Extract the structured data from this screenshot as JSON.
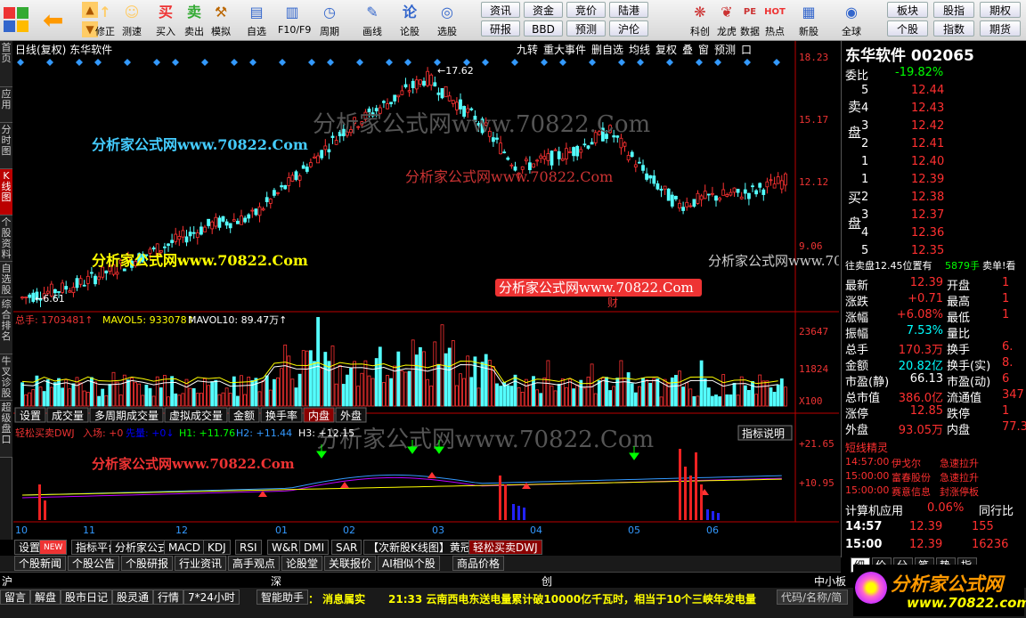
{
  "toolbar": {
    "items": [
      {
        "label": "修正",
        "icon": "↑"
      },
      {
        "label": "测速",
        "icon": "☺"
      },
      {
        "label": "买入",
        "icon": "买"
      },
      {
        "label": "卖出",
        "icon": "卖"
      },
      {
        "label": "模拟",
        "icon": "⚒"
      },
      {
        "label": "自选",
        "icon": "▤"
      },
      {
        "label": "F10/F9",
        "icon": "▥"
      },
      {
        "label": "周期",
        "icon": "◷"
      },
      {
        "label": "画线",
        "icon": "✎"
      },
      {
        "label": "论股",
        "icon": "论"
      },
      {
        "label": "选股",
        "icon": "◎"
      },
      {
        "label": "科创",
        "icon": "❋"
      },
      {
        "label": "龙虎",
        "icon": "❦"
      },
      {
        "label": "数据",
        "icon": "PE"
      },
      {
        "label": "热点",
        "icon": "HOT"
      },
      {
        "label": "新股",
        "icon": "▦"
      },
      {
        "label": "全球",
        "icon": "◉"
      }
    ],
    "quick": [
      [
        "资讯",
        "研报"
      ],
      [
        "资金",
        "BBD"
      ],
      [
        "竞价",
        "预测"
      ],
      [
        "陆港",
        "沪伦"
      ]
    ],
    "right": [
      [
        "板块",
        "个股"
      ],
      [
        "股指",
        "指数"
      ],
      [
        "期权",
        "期货"
      ]
    ]
  },
  "leftnav": [
    "首页",
    "应用",
    "分时图",
    "K线图",
    "个股资料",
    "自选股",
    "综合排名",
    "牛叉诊股",
    "超级盘口"
  ],
  "chart": {
    "title": "日线(复权) 东华软件",
    "options": [
      "九转",
      "重大事件",
      "删自选",
      "均线",
      "复权",
      "叠",
      "窗",
      "预测",
      "口"
    ],
    "price_axis": [
      "18.23",
      "15.17",
      "12.12",
      "9.06"
    ],
    "high_label": "17.62",
    "low_label": "6.61",
    "cai": "财",
    "watermarks": [
      "分析家公式网www.70822.Com",
      "分析家公式网www.70822.Com",
      "分析家公式网www.70822.Com",
      "分析家公式网www.70822.Com",
      "分析家公式网www.70822.Com",
      "分析家公式网www.70822.Com",
      "分析家公式网www.70822.Com"
    ],
    "volume_header": {
      "total": "总手: 1703481↑",
      "ma5": "MAVOL5: 933078↑",
      "ma10": "MAVOL10: 89.47万↑"
    },
    "volume_axis": [
      "23647",
      "11824",
      "X100"
    ],
    "tabs1": [
      "设置",
      "成交量",
      "多周期成交量",
      "虚拟成交量",
      "金额",
      "换手率",
      "内盘",
      "外盘"
    ],
    "indicator_header": {
      "name": "轻松买卖DWJ",
      "entry": "入场: +0",
      "first": "先量: +0↓",
      "h1": "H1: +11.76",
      "h2": "H2: +11.44",
      "h3": "H3: +12.15"
    },
    "indicator_axis": [
      "+21.65",
      "+10.95"
    ],
    "indicator_button": "指标说明",
    "x_axis": [
      "10",
      "11",
      "12",
      "01",
      "02",
      "03",
      "04",
      "05",
      "06"
    ]
  },
  "chart_data": {
    "type": "candlestick",
    "title": "日线(复权) 东华软件",
    "ylim": [
      6.61,
      18.23
    ],
    "x": [
      "10",
      "11",
      "12",
      "01",
      "02",
      "03",
      "04",
      "05",
      "06"
    ],
    "series": [
      {
        "name": "收盘",
        "values": [
          6.61,
          7.2,
          8.4,
          9.6,
          12.5,
          17.62,
          13.4,
          15.2,
          12.12,
          12.39
        ]
      }
    ]
  },
  "rpanel": {
    "title": "东华软件 002065",
    "webi": "委比",
    "webi_val": "-19.82%",
    "sell": [
      [
        "5",
        "12.44"
      ],
      [
        "4",
        "12.43"
      ],
      [
        "3",
        "12.42"
      ],
      [
        "2",
        "12.41"
      ],
      [
        "1",
        "12.40"
      ]
    ],
    "buy": [
      [
        "1",
        "12.39"
      ],
      [
        "2",
        "12.38"
      ],
      [
        "3",
        "12.37"
      ],
      [
        "4",
        "12.36"
      ],
      [
        "5",
        "12.35"
      ]
    ],
    "sell_label": "卖盘",
    "buy_label": "买盘",
    "info": "往卖盘12.45位置有",
    "info2": "5879手",
    "info3": "卖单!看",
    "stats": [
      [
        "最新",
        "12.39",
        "开盘",
        "1"
      ],
      [
        "涨跌",
        "+0.71",
        "最高",
        "1"
      ],
      [
        "涨幅",
        "+6.08%",
        "最低",
        "1"
      ],
      [
        "振幅",
        "7.53%",
        "量比",
        ""
      ],
      [
        "总手",
        "170.3万",
        "换手",
        "6."
      ],
      [
        "金额",
        "20.82亿",
        "换手(实)",
        "8."
      ],
      [
        "市盈(静)",
        "66.13",
        "市盈(动)",
        "6"
      ],
      [
        "总市值",
        "386.0亿",
        "流通值",
        "347"
      ],
      [
        "涨停",
        "12.85",
        "跌停",
        "1"
      ],
      [
        "外盘",
        "93.05万",
        "内盘",
        "77.3"
      ]
    ],
    "shortline": "短线精灵",
    "events": [
      [
        "14:57:00",
        "伊戈尔",
        "急速拉升"
      ],
      [
        "15:00:00",
        "富春股份",
        "急速拉升"
      ],
      [
        "15:00:00",
        "赛意信息",
        "封涨停板"
      ]
    ],
    "calc": "计算机应用",
    "calc_val": "0.06%",
    "calc_r": "同行比",
    "ticks": [
      [
        "14:57",
        "12.39",
        "155"
      ],
      [
        "15:00",
        "12.39",
        "16236"
      ]
    ],
    "bottom_tabs": [
      "细",
      "价",
      "分",
      "笔",
      "势",
      "指"
    ]
  },
  "btm1": [
    "设置",
    "NEW",
    "指标平台",
    "分析家公式网",
    "MACD",
    "KDJ",
    "RSI",
    "W&R",
    "DMI",
    "SAR",
    "【次新股K线图】黄冠...",
    "轻松买卖DWJ"
  ],
  "btm2": [
    "个股新闻",
    "个股公告",
    "个股研报",
    "行业资讯",
    "高手观点",
    "论股堂",
    "关联报价",
    "AI相似个股",
    "商品价格"
  ],
  "index_bar": [
    "沪",
    "深",
    "创",
    "中小板"
  ],
  "status": {
    "items": [
      "留言",
      "解盘",
      "股市日记",
      "股灵通",
      "行情",
      "7*24小时",
      "智能助手"
    ],
    "news_label": "消息属实",
    "news": "21:33 云南西电东送电量累计破10000亿千瓦时，相当于10个三峡年发电量",
    "search": "代码/名称/简拼",
    "logo": "分析家公式网",
    "logo_url": "www.70822.com"
  }
}
